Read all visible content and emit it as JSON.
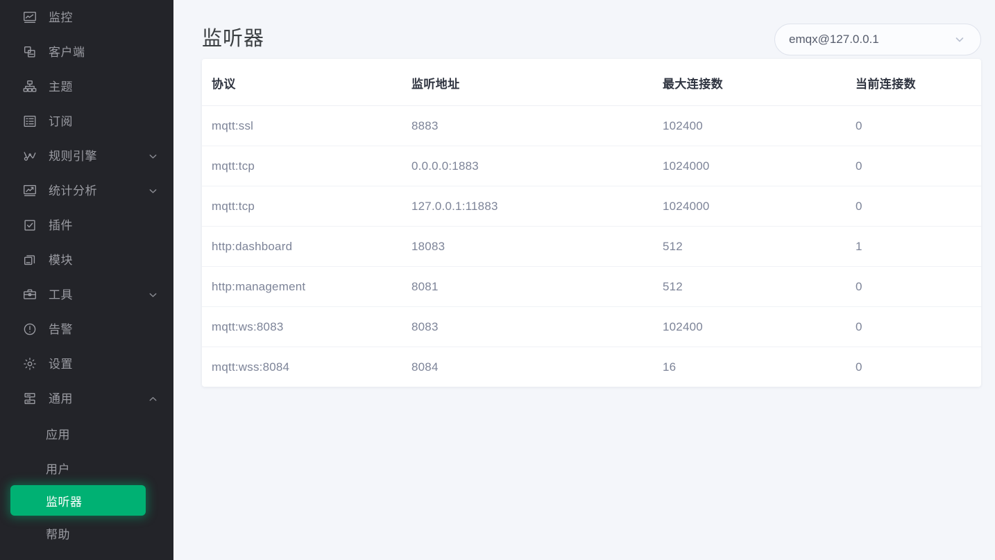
{
  "sidebar": {
    "items": [
      {
        "label": "监控",
        "icon": "monitor-icon",
        "expandable": false,
        "caret": null
      },
      {
        "label": "客户端",
        "icon": "clients-icon",
        "expandable": false,
        "caret": null
      },
      {
        "label": "主题",
        "icon": "topics-icon",
        "expandable": false,
        "caret": null
      },
      {
        "label": "订阅",
        "icon": "subscriptions-icon",
        "expandable": false,
        "caret": null
      },
      {
        "label": "规则引擎",
        "icon": "rule-engine-icon",
        "expandable": true,
        "caret": "chevron-down-icon"
      },
      {
        "label": "统计分析",
        "icon": "analytics-icon",
        "expandable": true,
        "caret": "chevron-down-icon"
      },
      {
        "label": "插件",
        "icon": "plugins-icon",
        "expandable": false,
        "caret": null
      },
      {
        "label": "模块",
        "icon": "modules-icon",
        "expandable": false,
        "caret": null
      },
      {
        "label": "工具",
        "icon": "tools-icon",
        "expandable": true,
        "caret": "chevron-down-icon"
      },
      {
        "label": "告警",
        "icon": "alarm-icon",
        "expandable": false,
        "caret": null
      },
      {
        "label": "设置",
        "icon": "settings-icon",
        "expandable": false,
        "caret": null
      },
      {
        "label": "通用",
        "icon": "general-icon",
        "expandable": true,
        "caret": "chevron-up-icon"
      }
    ],
    "sub_items": [
      {
        "label": "应用",
        "active": false
      },
      {
        "label": "用户",
        "active": false
      },
      {
        "label": "监听器",
        "active": true
      },
      {
        "label": "帮助",
        "active": false
      }
    ],
    "active_color": "#00b173",
    "background": "#232429"
  },
  "header": {
    "title": "监听器",
    "node_select": {
      "value": "emqx@127.0.0.1",
      "caret_icon": "chevron-down-icon"
    }
  },
  "table": {
    "columns": [
      "协议",
      "监听地址",
      "最大连接数",
      "当前连接数"
    ],
    "rows": [
      {
        "protocol": "mqtt:ssl",
        "address": "8883",
        "max_conn": "102400",
        "current_conn": "0"
      },
      {
        "protocol": "mqtt:tcp",
        "address": "0.0.0.0:1883",
        "max_conn": "1024000",
        "current_conn": "0"
      },
      {
        "protocol": "mqtt:tcp",
        "address": "127.0.0.1:11883",
        "max_conn": "1024000",
        "current_conn": "0"
      },
      {
        "protocol": "http:dashboard",
        "address": "18083",
        "max_conn": "512",
        "current_conn": "1"
      },
      {
        "protocol": "http:management",
        "address": "8081",
        "max_conn": "512",
        "current_conn": "0"
      },
      {
        "protocol": "mqtt:ws:8083",
        "address": "8083",
        "max_conn": "102400",
        "current_conn": "0"
      },
      {
        "protocol": "mqtt:wss:8084",
        "address": "8084",
        "max_conn": "16",
        "current_conn": "0"
      }
    ]
  }
}
